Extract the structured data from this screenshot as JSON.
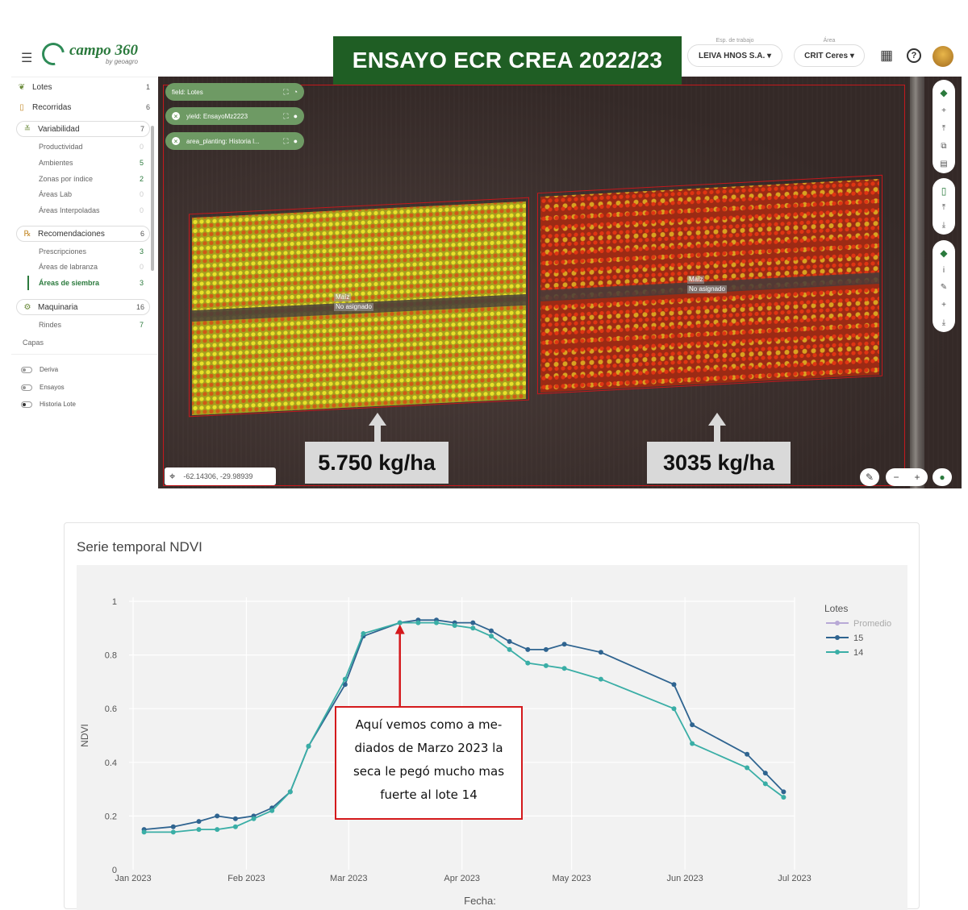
{
  "header": {
    "logo_text": "campo 360",
    "logo_sub": "by geoagro",
    "banner": "ENSAYO ECR CREA 2022/23",
    "workspace_caption": "Esp. de trabajo",
    "workspace_value": "LEIVA HNOS S.A. ▾",
    "area_caption": "Área",
    "area_value": "CRIT Ceres ▾",
    "icons": [
      "menu-icon",
      "apps-grid-icon",
      "help-icon",
      "avatar"
    ]
  },
  "sidebar": {
    "items": [
      {
        "label": "Lotes",
        "count": "1",
        "icon": "sprout-icon"
      },
      {
        "label": "Recorridas",
        "count": "6",
        "icon": "clipboard-icon"
      },
      {
        "label": "Variabilidad",
        "count": "7",
        "icon": "layers-icon"
      },
      {
        "label": "Recomendaciones",
        "count": "6",
        "icon": "rx-icon"
      },
      {
        "label": "Maquinaria",
        "count": "16",
        "icon": "tractor-icon"
      }
    ],
    "variabilidad_sub": [
      {
        "label": "Productividad",
        "count": "0"
      },
      {
        "label": "Ambientes",
        "count": "5"
      },
      {
        "label": "Zonas por índice",
        "count": "2"
      },
      {
        "label": "Áreas Lab",
        "count": "0"
      },
      {
        "label": "Áreas Interpoladas",
        "count": "0"
      }
    ],
    "recomendaciones_sub": [
      {
        "label": "Prescripciones",
        "count": "3"
      },
      {
        "label": "Áreas de labranza",
        "count": "0"
      },
      {
        "label": "Áreas de siembra",
        "count": "3"
      }
    ],
    "maquinaria_sub": [
      {
        "label": "Rindes",
        "count": "7"
      }
    ],
    "capas_title": "Capas",
    "capas": [
      {
        "label": "Deriva",
        "on": false
      },
      {
        "label": "Ensayos",
        "on": false
      },
      {
        "label": "Historia Lote",
        "on": true
      }
    ]
  },
  "map": {
    "layers": [
      {
        "label": "field: Lotes"
      },
      {
        "label": "yield: EnsayoMz2223"
      },
      {
        "label": "area_planting: Historia l..."
      }
    ],
    "plot_labels": [
      {
        "crop": "Maíz",
        "status": "No asignado"
      },
      {
        "crop": "Maíz",
        "status": "No asignado"
      }
    ],
    "coords": "-62.14306, -29.98939",
    "yield_left": "5.750 kg/ha",
    "yield_right": "3035 kg/ha",
    "zoom_out": "−",
    "zoom_in": "+"
  },
  "chart_card": {
    "title": "Serie temporal NDVI",
    "callout": [
      "Aquí vemos como a me-",
      "diados de Marzo 2023 la",
      "seca le pegó mucho mas",
      "fuerte al lote 14"
    ]
  },
  "chart_data": {
    "type": "line",
    "xlabel": "Fecha:",
    "ylabel": "NDVI",
    "ylim": [
      0,
      1
    ],
    "yticks": [
      "0",
      "0.2",
      "0.4",
      "0.6",
      "0.8",
      "1"
    ],
    "xticks": [
      "Jan 2023",
      "Feb 2023",
      "Mar 2023",
      "Apr 2023",
      "May 2023",
      "Jun 2023",
      "Jul 2023"
    ],
    "grid": true,
    "legend_title": "Lotes",
    "legend_position": "right",
    "colors": {
      "Promedio": "#b8a9d6",
      "15": "#2f6490",
      "14": "#3aaea6"
    },
    "series": [
      {
        "name": "Promedio",
        "points": []
      },
      {
        "name": "15",
        "points": [
          [
            "2023-01-04",
            0.15
          ],
          [
            "2023-01-12",
            0.16
          ],
          [
            "2023-01-19",
            0.18
          ],
          [
            "2023-01-24",
            0.2
          ],
          [
            "2023-01-29",
            0.19
          ],
          [
            "2023-02-03",
            0.2
          ],
          [
            "2023-02-08",
            0.23
          ],
          [
            "2023-02-13",
            0.29
          ],
          [
            "2023-02-18",
            0.46
          ],
          [
            "2023-02-28",
            0.69
          ],
          [
            "2023-03-05",
            0.87
          ],
          [
            "2023-03-15",
            0.92
          ],
          [
            "2023-03-20",
            0.93
          ],
          [
            "2023-03-25",
            0.93
          ],
          [
            "2023-03-30",
            0.92
          ],
          [
            "2023-04-04",
            0.92
          ],
          [
            "2023-04-09",
            0.89
          ],
          [
            "2023-04-14",
            0.85
          ],
          [
            "2023-04-19",
            0.82
          ],
          [
            "2023-04-24",
            0.82
          ],
          [
            "2023-04-29",
            0.84
          ],
          [
            "2023-05-09",
            0.81
          ],
          [
            "2023-05-29",
            0.69
          ],
          [
            "2023-06-03",
            0.54
          ],
          [
            "2023-06-18",
            0.43
          ],
          [
            "2023-06-23",
            0.36
          ],
          [
            "2023-06-28",
            0.29
          ]
        ]
      },
      {
        "name": "14",
        "points": [
          [
            "2023-01-04",
            0.14
          ],
          [
            "2023-01-12",
            0.14
          ],
          [
            "2023-01-19",
            0.15
          ],
          [
            "2023-01-24",
            0.15
          ],
          [
            "2023-01-29",
            0.16
          ],
          [
            "2023-02-03",
            0.19
          ],
          [
            "2023-02-08",
            0.22
          ],
          [
            "2023-02-13",
            0.29
          ],
          [
            "2023-02-18",
            0.46
          ],
          [
            "2023-02-28",
            0.71
          ],
          [
            "2023-03-05",
            0.88
          ],
          [
            "2023-03-15",
            0.92
          ],
          [
            "2023-03-20",
            0.92
          ],
          [
            "2023-03-25",
            0.92
          ],
          [
            "2023-03-30",
            0.91
          ],
          [
            "2023-04-04",
            0.9
          ],
          [
            "2023-04-09",
            0.87
          ],
          [
            "2023-04-14",
            0.82
          ],
          [
            "2023-04-19",
            0.77
          ],
          [
            "2023-04-24",
            0.76
          ],
          [
            "2023-04-29",
            0.75
          ],
          [
            "2023-05-09",
            0.71
          ],
          [
            "2023-05-29",
            0.6
          ],
          [
            "2023-06-03",
            0.47
          ],
          [
            "2023-06-18",
            0.38
          ],
          [
            "2023-06-23",
            0.32
          ],
          [
            "2023-06-28",
            0.27
          ]
        ]
      }
    ],
    "annotation": {
      "x": "2023-03-15",
      "y": 0.92,
      "type": "arrow"
    }
  }
}
